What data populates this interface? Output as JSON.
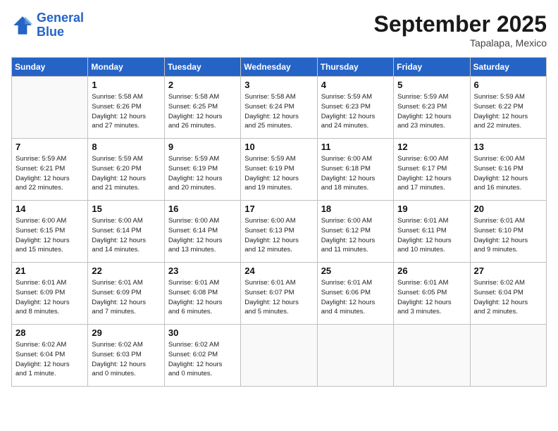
{
  "logo": {
    "line1": "General",
    "line2": "Blue"
  },
  "month": "September 2025",
  "location": "Tapalapa, Mexico",
  "weekdays": [
    "Sunday",
    "Monday",
    "Tuesday",
    "Wednesday",
    "Thursday",
    "Friday",
    "Saturday"
  ],
  "weeks": [
    [
      {
        "day": "",
        "info": ""
      },
      {
        "day": "1",
        "info": "Sunrise: 5:58 AM\nSunset: 6:26 PM\nDaylight: 12 hours\nand 27 minutes."
      },
      {
        "day": "2",
        "info": "Sunrise: 5:58 AM\nSunset: 6:25 PM\nDaylight: 12 hours\nand 26 minutes."
      },
      {
        "day": "3",
        "info": "Sunrise: 5:58 AM\nSunset: 6:24 PM\nDaylight: 12 hours\nand 25 minutes."
      },
      {
        "day": "4",
        "info": "Sunrise: 5:59 AM\nSunset: 6:23 PM\nDaylight: 12 hours\nand 24 minutes."
      },
      {
        "day": "5",
        "info": "Sunrise: 5:59 AM\nSunset: 6:23 PM\nDaylight: 12 hours\nand 23 minutes."
      },
      {
        "day": "6",
        "info": "Sunrise: 5:59 AM\nSunset: 6:22 PM\nDaylight: 12 hours\nand 22 minutes."
      }
    ],
    [
      {
        "day": "7",
        "info": "Sunrise: 5:59 AM\nSunset: 6:21 PM\nDaylight: 12 hours\nand 22 minutes."
      },
      {
        "day": "8",
        "info": "Sunrise: 5:59 AM\nSunset: 6:20 PM\nDaylight: 12 hours\nand 21 minutes."
      },
      {
        "day": "9",
        "info": "Sunrise: 5:59 AM\nSunset: 6:19 PM\nDaylight: 12 hours\nand 20 minutes."
      },
      {
        "day": "10",
        "info": "Sunrise: 5:59 AM\nSunset: 6:19 PM\nDaylight: 12 hours\nand 19 minutes."
      },
      {
        "day": "11",
        "info": "Sunrise: 6:00 AM\nSunset: 6:18 PM\nDaylight: 12 hours\nand 18 minutes."
      },
      {
        "day": "12",
        "info": "Sunrise: 6:00 AM\nSunset: 6:17 PM\nDaylight: 12 hours\nand 17 minutes."
      },
      {
        "day": "13",
        "info": "Sunrise: 6:00 AM\nSunset: 6:16 PM\nDaylight: 12 hours\nand 16 minutes."
      }
    ],
    [
      {
        "day": "14",
        "info": "Sunrise: 6:00 AM\nSunset: 6:15 PM\nDaylight: 12 hours\nand 15 minutes."
      },
      {
        "day": "15",
        "info": "Sunrise: 6:00 AM\nSunset: 6:14 PM\nDaylight: 12 hours\nand 14 minutes."
      },
      {
        "day": "16",
        "info": "Sunrise: 6:00 AM\nSunset: 6:14 PM\nDaylight: 12 hours\nand 13 minutes."
      },
      {
        "day": "17",
        "info": "Sunrise: 6:00 AM\nSunset: 6:13 PM\nDaylight: 12 hours\nand 12 minutes."
      },
      {
        "day": "18",
        "info": "Sunrise: 6:00 AM\nSunset: 6:12 PM\nDaylight: 12 hours\nand 11 minutes."
      },
      {
        "day": "19",
        "info": "Sunrise: 6:01 AM\nSunset: 6:11 PM\nDaylight: 12 hours\nand 10 minutes."
      },
      {
        "day": "20",
        "info": "Sunrise: 6:01 AM\nSunset: 6:10 PM\nDaylight: 12 hours\nand 9 minutes."
      }
    ],
    [
      {
        "day": "21",
        "info": "Sunrise: 6:01 AM\nSunset: 6:09 PM\nDaylight: 12 hours\nand 8 minutes."
      },
      {
        "day": "22",
        "info": "Sunrise: 6:01 AM\nSunset: 6:09 PM\nDaylight: 12 hours\nand 7 minutes."
      },
      {
        "day": "23",
        "info": "Sunrise: 6:01 AM\nSunset: 6:08 PM\nDaylight: 12 hours\nand 6 minutes."
      },
      {
        "day": "24",
        "info": "Sunrise: 6:01 AM\nSunset: 6:07 PM\nDaylight: 12 hours\nand 5 minutes."
      },
      {
        "day": "25",
        "info": "Sunrise: 6:01 AM\nSunset: 6:06 PM\nDaylight: 12 hours\nand 4 minutes."
      },
      {
        "day": "26",
        "info": "Sunrise: 6:01 AM\nSunset: 6:05 PM\nDaylight: 12 hours\nand 3 minutes."
      },
      {
        "day": "27",
        "info": "Sunrise: 6:02 AM\nSunset: 6:04 PM\nDaylight: 12 hours\nand 2 minutes."
      }
    ],
    [
      {
        "day": "28",
        "info": "Sunrise: 6:02 AM\nSunset: 6:04 PM\nDaylight: 12 hours\nand 1 minute."
      },
      {
        "day": "29",
        "info": "Sunrise: 6:02 AM\nSunset: 6:03 PM\nDaylight: 12 hours\nand 0 minutes."
      },
      {
        "day": "30",
        "info": "Sunrise: 6:02 AM\nSunset: 6:02 PM\nDaylight: 12 hours\nand 0 minutes."
      },
      {
        "day": "",
        "info": ""
      },
      {
        "day": "",
        "info": ""
      },
      {
        "day": "",
        "info": ""
      },
      {
        "day": "",
        "info": ""
      }
    ]
  ]
}
